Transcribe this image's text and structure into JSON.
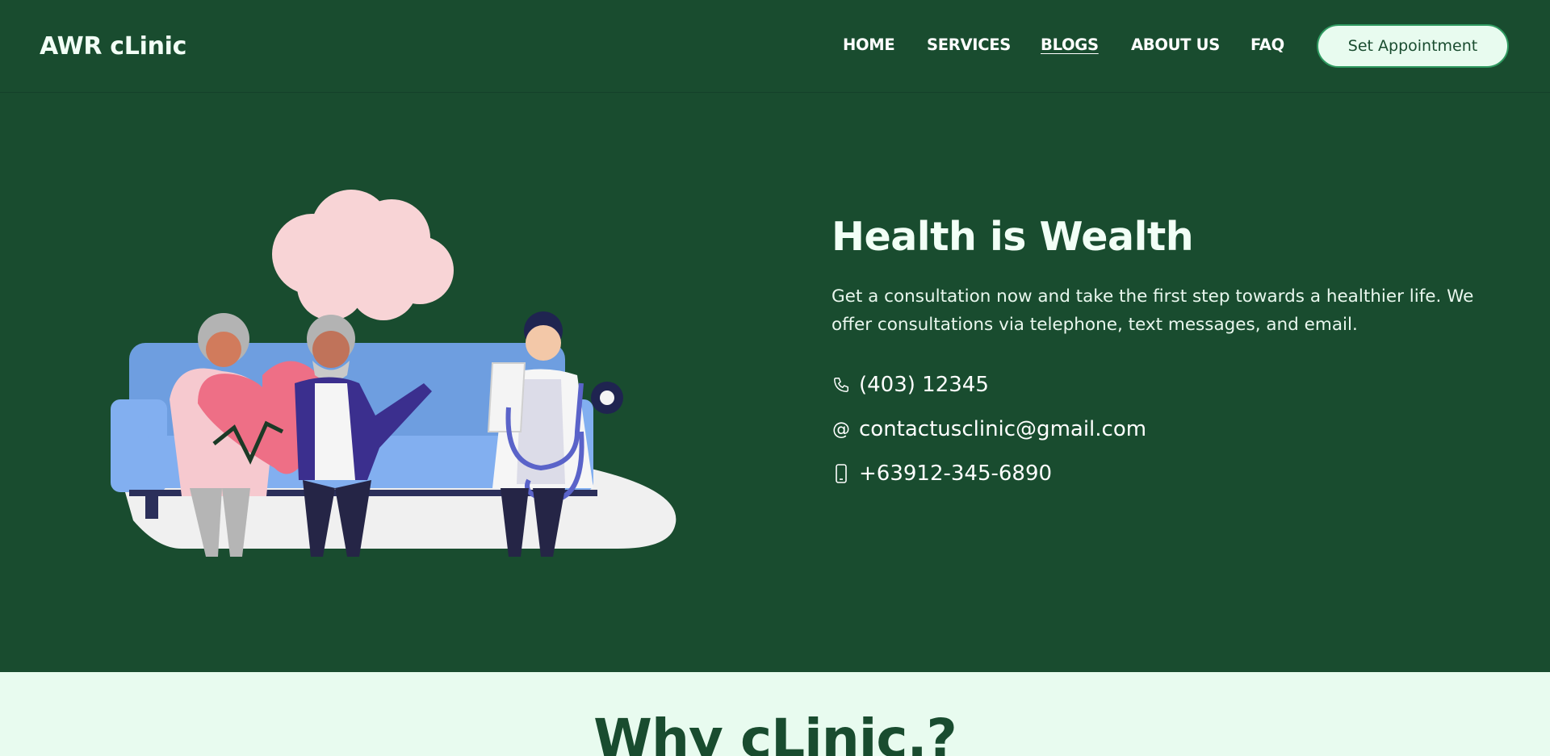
{
  "header": {
    "logo": "AWR cLinic",
    "nav": [
      {
        "label": "HOME",
        "active": false
      },
      {
        "label": "SERVICES",
        "active": false
      },
      {
        "label": "BLOGS",
        "active": true
      },
      {
        "label": "ABOUT US",
        "active": false
      },
      {
        "label": "FAQ",
        "active": false
      }
    ],
    "cta_label": "Set Appointment"
  },
  "hero": {
    "title": "Health is Wealth",
    "description": "Get a consultation now and take the first step towards a healthier life. We offer consultations via telephone, text messages, and email.",
    "contacts": [
      {
        "icon": "phone-icon",
        "text": "(403) 12345"
      },
      {
        "icon": "at-sign-icon",
        "text": "contactusclinic@gmail.com"
      },
      {
        "icon": "mobile-phone-icon",
        "text": "+63912-345-6890"
      }
    ]
  },
  "why": {
    "title": "Why cLinic.?"
  },
  "colors": {
    "primary_green": "#194c2f",
    "light_mint": "#e8fbef",
    "cta_border": "#2f9a60"
  }
}
